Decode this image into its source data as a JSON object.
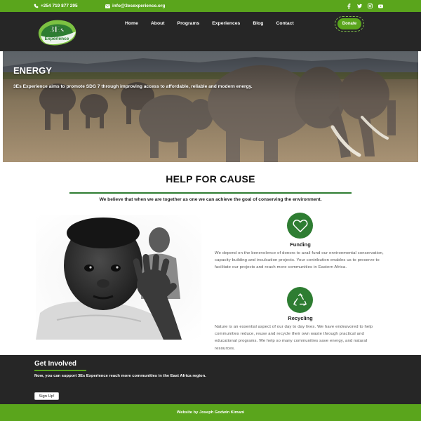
{
  "topbar": {
    "phone": "+254 719 877 295",
    "email": "info@3esexperience.org",
    "socials": [
      "facebook-icon",
      "twitter-icon",
      "instagram-icon",
      "youtube-icon"
    ]
  },
  "nav": {
    "logo_text": "3Es",
    "logo_sub": "Experience",
    "items": [
      "Home",
      "About",
      "Programs",
      "Experiences",
      "Blog",
      "Contact"
    ],
    "donate_label": "Donate"
  },
  "hero": {
    "title": "ENERGY",
    "subtitle": "3Es Experience aims to promote SDG 7 through improving access to affordable, reliable and modern energy."
  },
  "help": {
    "title": "HELP FOR CAUSE",
    "lead": "We believe that when we are together as one we can achieve the goal of conserving the environment.",
    "features": [
      {
        "icon": "heart-icon",
        "title": "Funding",
        "text": "We depend on the benevolence of donors to avail fund our environmental conservation, capacity building and inculcation projects. Your contribution enables us to preserve to facilitate our projects and reach more communities in Eastern Africa."
      },
      {
        "icon": "recycle-icon",
        "title": "Recycling",
        "text": "Nature is an essential aspect of our day to day lives. We have endeavored to help communities reduce, reuse and recycle their own waste through practical and educational programs. We help so many communities save energy, and natural resources."
      }
    ]
  },
  "involved": {
    "title": "Get Involved",
    "text": "Now, you can support 3Es Experience reach more communities in the East Africa region.",
    "button": "Sign Up!"
  },
  "footer": {
    "credit": "Website by Joseph Godwin Kimani"
  },
  "colors": {
    "brand_green": "#5aa51c",
    "dark_green": "#2e7d32",
    "dark_bg": "#262626"
  }
}
